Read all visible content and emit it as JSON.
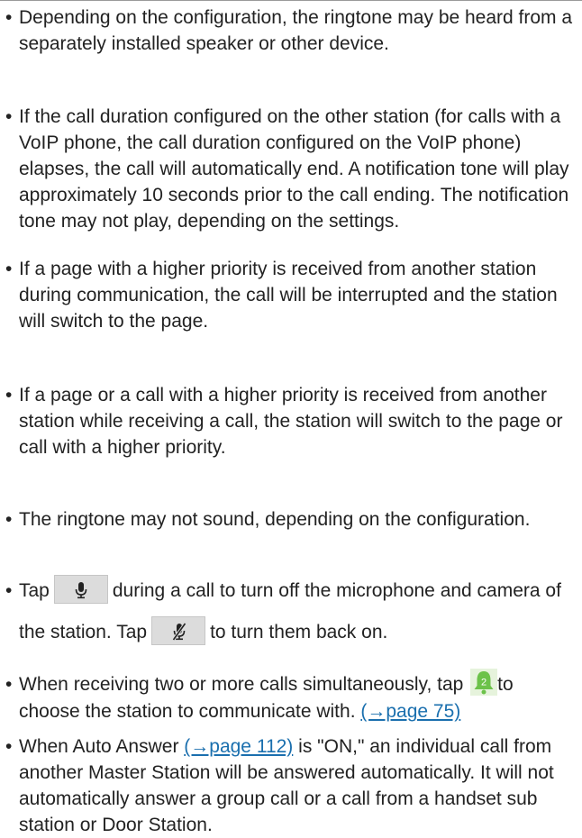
{
  "bullet_char": "•",
  "items": [
    {
      "text": "Depending on the configuration, the ringtone may be heard from a separately installed speaker or other device."
    },
    {
      "text": "If the call duration configured on the other station (for calls with a VoIP phone, the call duration configured on the VoIP phone) elapses, the call will automatically end. A notification tone will play approximately 10 seconds prior to the call ending. The notification tone may not play, depending on the settings."
    },
    {
      "text": "If a page with a higher priority is received from another station during communication, the call will be interrupted and the station will switch to the page."
    },
    {
      "text": "If a page or a call with a higher priority is received from another station while receiving a call, the station will switch to the page or call with a higher priority."
    },
    {
      "text": "The ringtone may not sound, depending on the configuration."
    },
    {
      "text_1": "Tap",
      "icon_1": "microphone-icon",
      "text_2": "during a call to turn off the microphone and camera of the station.  Tap",
      "icon_2": "microphone-off-icon",
      "text_3": "to turn them back on."
    },
    {
      "text_1": "When receiving two or more calls simultaneously, tap",
      "icon": "bell-2-icon",
      "bell_badge": "2",
      "text_2": "to choose the station to communicate with.",
      "link": "(→page 75)"
    },
    {
      "text_1": "When Auto Answer",
      "link": "(→page 112)",
      "text_2": "is \"ON,\" an individual call from another Master Station will be answered automatically. It will not automatically answer a group call or a call from a handset sub station or Door Station."
    }
  ],
  "colors": {
    "text": "#222222",
    "link": "#1a6fae",
    "button_bg": "#dcdcdc",
    "bell_green": "#6cc24a"
  }
}
